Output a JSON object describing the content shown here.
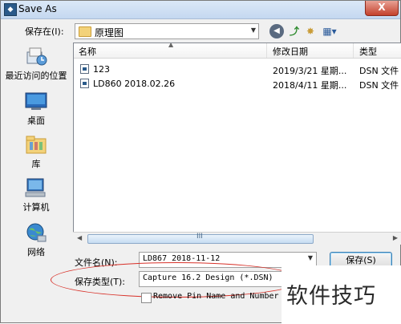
{
  "window": {
    "title": "Save As",
    "close_label": "X"
  },
  "toolbar": {
    "save_in_label": "保存在(I):",
    "location": "原理图"
  },
  "places": [
    {
      "label": "最近访问的位置",
      "icon": "recent-places-icon"
    },
    {
      "label": "桌面",
      "icon": "desktop-icon"
    },
    {
      "label": "库",
      "icon": "libraries-icon"
    },
    {
      "label": "计算机",
      "icon": "computer-icon"
    },
    {
      "label": "网络",
      "icon": "network-icon"
    }
  ],
  "file_list": {
    "columns": [
      "名称",
      "修改日期",
      "类型"
    ],
    "rows": [
      {
        "name": "123",
        "date": "2019/3/21 星期...",
        "type": "DSN 文件"
      },
      {
        "name": "LD860 2018.02.26",
        "date": "2018/4/11 星期...",
        "type": "DSN 文件"
      }
    ],
    "scroll_grip": "III"
  },
  "form": {
    "filename_label": "文件名(N):",
    "filename_value": "LD867 2018-11-12",
    "filetype_label": "保存类型(T):",
    "filetype_value": "Capture 16.2 Design (*.DSN)",
    "save_button": "保存(S)",
    "checkbox_label": "Remove Pin Name and Number Mov"
  },
  "watermark": "软件技巧",
  "colors": {
    "highlight": "#d8322a",
    "accent": "#3c7fb1"
  }
}
